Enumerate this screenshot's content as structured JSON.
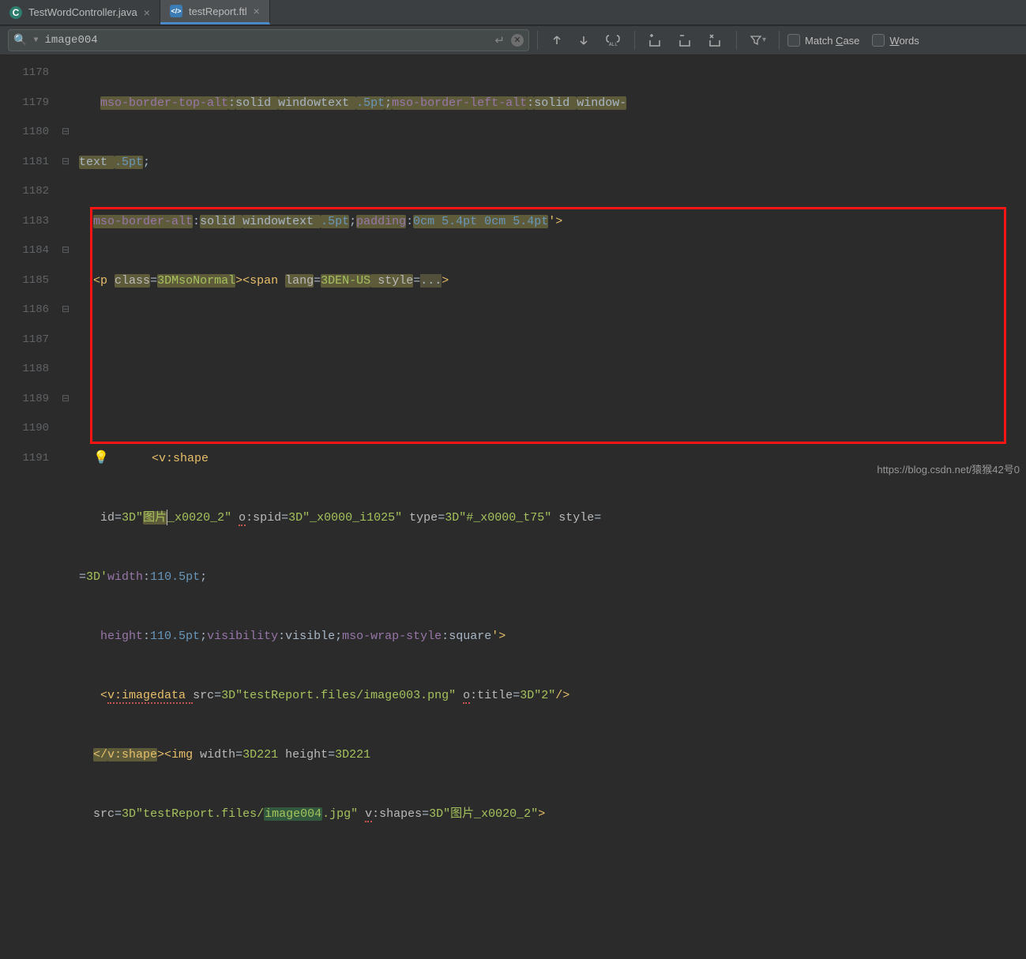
{
  "tabs": [
    {
      "icon": "C",
      "iconClass": "java",
      "label": "TestWordController.java",
      "active": false
    },
    {
      "icon": "</>",
      "iconClass": "ftl",
      "label": "testReport.ftl",
      "active": true
    }
  ],
  "find": {
    "query": "image004",
    "matchCase": {
      "text": "Match ",
      "underChar": "C",
      "rest": "ase"
    },
    "words": {
      "underChar": "W",
      "rest": "ords"
    }
  },
  "gutter": [
    "1178",
    "1179",
    "1180",
    "1181",
    "1182",
    "1183",
    "1184",
    "1185",
    "1186",
    "1187",
    "1188",
    "1189",
    "1190",
    "1191"
  ],
  "fold": [
    "",
    "",
    "⊟",
    "⊟",
    "",
    "",
    "⊟",
    "",
    "⊟",
    "",
    "",
    "⊟",
    "",
    ""
  ],
  "code": {
    "r1178": {
      "a": "mso-border-top-alt",
      "b": ":",
      "c": "solid ",
      "d": "windowtext ",
      "e": ".5pt",
      "f": ";",
      "g": "mso-border-left-alt",
      "h": ":",
      "i": "solid ",
      "j": "window-"
    },
    "r1179": {
      "a": "text ",
      "b": ".5pt",
      "c": ";"
    },
    "r1180": {
      "a": "mso-border-alt",
      "b": ":",
      "c": "solid ",
      "d": "windowtext ",
      "e": ".5pt",
      "f": ";",
      "g": "padding",
      "h": ":",
      "i": "0cm 5.4pt 0cm 5.4pt",
      "j": "'>"
    },
    "r1181": {
      "a": "<",
      "b": "p ",
      "c": "class",
      "d": "=",
      "e": "3DMsoNormal",
      "f": "><",
      "g": "span ",
      "h": "lang",
      "i": "=",
      "j": "3DEN-US",
      "k": " style",
      "l": "=",
      "m": "...",
      "n": ">"
    },
    "r1184": {
      "a": "<",
      "b": "v:shape"
    },
    "r1185": {
      "a": "id",
      "b": "=",
      "c": "3D\"",
      "d": "图片",
      "e": "_x0020_2\" ",
      "f": "o",
      "g": ":spid",
      "h": "=",
      "i": "3D\"_x0000_i1025\"",
      "j": " type",
      "k": "=",
      "l": "3D\"#_x0000_t75\"",
      "m": " style",
      "n": "="
    },
    "r1186": {
      "a": "=",
      "b": "3D'",
      "c": "width",
      "d": ":",
      "e": "110.5pt",
      "f": ";"
    },
    "r1187": {
      "a": "height",
      "b": ":",
      "c": "110.5pt",
      "d": ";",
      "e": "visibility",
      "f": ":",
      "g": "visible",
      "h": ";",
      "i": "mso-wrap-style",
      "j": ":",
      "k": "square",
      "l": "'>"
    },
    "r1188": {
      "a": "<",
      "b": "v:imagedata ",
      "c": "src",
      "d": "=",
      "e": "3D\"",
      "f": "testReport.files/image003.png\" ",
      "g": "o",
      "h": ":title",
      "i": "=",
      "j": "3D\"2\"",
      "k": "/>"
    },
    "r1189": {
      "a": "</",
      "b": "v:shape",
      "c": "><",
      "d": "img ",
      "e": "width",
      "f": "=",
      "g": "3D221",
      "h": " height",
      "i": "=",
      "j": "3D221"
    },
    "r1190": {
      "a": "src",
      "b": "=",
      "c": "3D\"",
      "d": "testReport.files/",
      "e": "image004",
      "f": ".jpg\" ",
      "g": "v",
      "h": ":shapes",
      "i": "=",
      "j": "3D\"图片_x0020_2\"",
      "k": ">"
    }
  },
  "watermark": "https://blog.csdn.net/猿猴42号0"
}
